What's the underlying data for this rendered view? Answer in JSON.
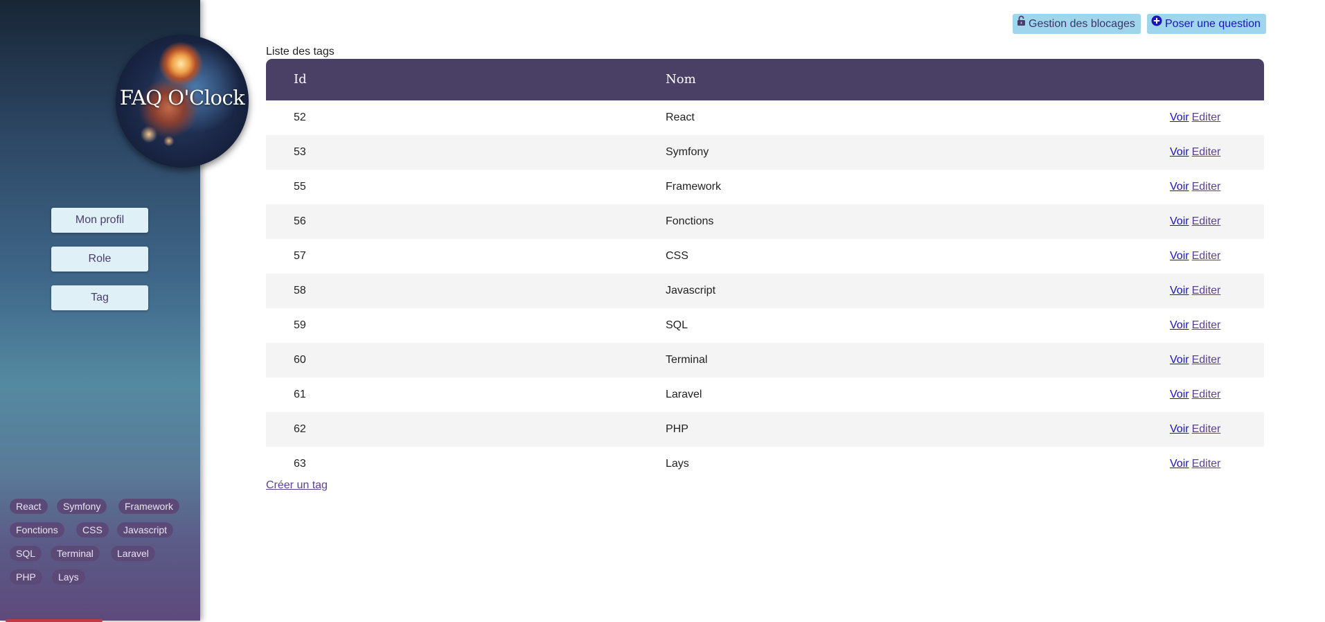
{
  "sidebar": {
    "logo_text": "FAQ O'Clock",
    "buttons": [
      "Mon profil",
      "Role",
      "Tag"
    ],
    "tag_rows": [
      [
        "React",
        "Symfony",
        "Framework"
      ],
      [
        "Fonctions",
        "CSS",
        "Javascript"
      ],
      [
        "SQL",
        "Terminal",
        "Laravel"
      ],
      [
        "PHP",
        "Lays"
      ]
    ]
  },
  "header": {
    "manage_blocks_label": "Gestion des blocages",
    "ask_question_label": "Poser une question"
  },
  "main": {
    "caption": "Liste des tags",
    "columns": [
      "Id",
      "Nom"
    ],
    "rows": [
      {
        "id": "52",
        "name": "React"
      },
      {
        "id": "53",
        "name": "Symfony"
      },
      {
        "id": "55",
        "name": "Framework"
      },
      {
        "id": "56",
        "name": "Fonctions"
      },
      {
        "id": "57",
        "name": "CSS"
      },
      {
        "id": "58",
        "name": "Javascript"
      },
      {
        "id": "59",
        "name": "SQL"
      },
      {
        "id": "60",
        "name": "Terminal"
      },
      {
        "id": "61",
        "name": "Laravel"
      },
      {
        "id": "62",
        "name": "PHP"
      },
      {
        "id": "63",
        "name": "Lays"
      }
    ],
    "view_label": "Voir",
    "edit_label": "Editer",
    "create_label": "Créer un tag"
  },
  "colors": {
    "table_header": "#4a3f64",
    "top_button_bg": "#9fd6ee",
    "sidebar_button_bg": "#dff0f7",
    "tag_pill_bg": "#5b4a78",
    "link_visited": "#5b3f94",
    "link": "#1a12c4"
  },
  "icons": {
    "manage_blocks": "unlock-icon",
    "ask_question": "plus-circle-icon"
  }
}
